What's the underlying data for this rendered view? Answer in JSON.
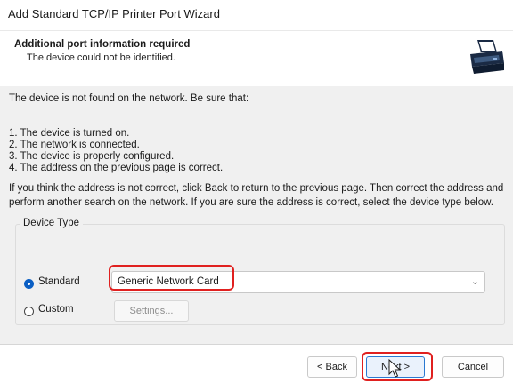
{
  "window": {
    "title": "Add Standard TCP/IP Printer Port Wizard"
  },
  "header": {
    "title": "Additional port information required",
    "subtitle": "The device could not be identified."
  },
  "content": {
    "intro": "The device is not found on the network.  Be sure that:",
    "checks": [
      "1.  The device is turned on.",
      "2.  The network is connected.",
      "3.  The device is properly configured.",
      "4.  The address on the previous page is correct."
    ],
    "instructions": "If you think the address is not correct, click Back to return to the previous page.  Then correct the address and perform another search on the network.  If you are sure the address is correct, select the device type below."
  },
  "device_type": {
    "legend": "Device Type",
    "standard_label": "Standard",
    "custom_label": "Custom",
    "selected_option": "standard",
    "standard_value": "Generic Network Card",
    "settings_label": "Settings..."
  },
  "footer": {
    "back_label": "< Back",
    "next_label": "Next >",
    "cancel_label": "Cancel"
  },
  "colors": {
    "highlight_outline": "#e0201f",
    "radio_selected": "#0b5fc4",
    "body_background": "#f0f0f0"
  },
  "icons": {
    "header_icon": "printer-port-icon",
    "dropdown": "chevron-down-icon",
    "pointer": "mouse-cursor-icon"
  }
}
